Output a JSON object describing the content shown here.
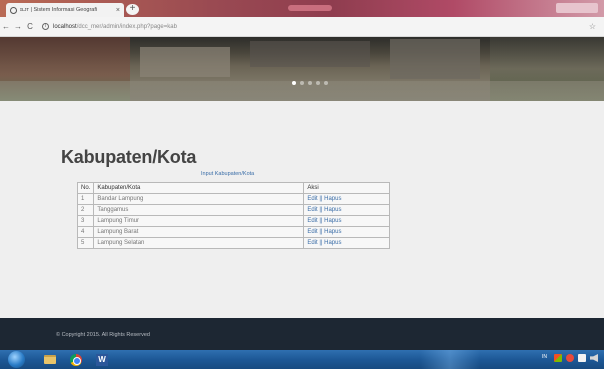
{
  "browser": {
    "tab_title": "ɪʟᴊᴛ | Sistem Informasi Geografi",
    "tab_close": "×",
    "new_tab": "+",
    "nav": {
      "back": "←",
      "forward": "→",
      "reload": "C"
    },
    "url_host": "localhost",
    "url_path": "/dcc_mer/admin/index.php?page=kab",
    "info_icon": "i",
    "star": "☆"
  },
  "hero": {
    "slides": 5,
    "active_slide": 1
  },
  "page": {
    "title": "Kabupaten/Kota",
    "input_link": "Input Kabupaten/Kota"
  },
  "table": {
    "headers": [
      "No.",
      "Kabupaten/Kota",
      "Aksi"
    ],
    "rows": [
      {
        "no": "1",
        "name": "Bandar Lampung",
        "aksi": "Edit || Hapus"
      },
      {
        "no": "2",
        "name": "Tanggamus",
        "aksi": "Edit || Hapus"
      },
      {
        "no": "3",
        "name": "Lampung Timur",
        "aksi": "Edit || Hapus"
      },
      {
        "no": "4",
        "name": "Lampung Barat",
        "aksi": "Edit || Hapus"
      },
      {
        "no": "5",
        "name": "Lampung Selatan",
        "aksi": "Edit || Hapus"
      }
    ]
  },
  "footer": {
    "text": "© Copyright 2015. All Rights Reserved"
  },
  "taskbar": {
    "word_letter": "W",
    "tray_lang": "IN"
  },
  "colors": {
    "link": "#3b6ea8",
    "footer_bg": "#1d2733",
    "content_bg": "#efefef"
  }
}
